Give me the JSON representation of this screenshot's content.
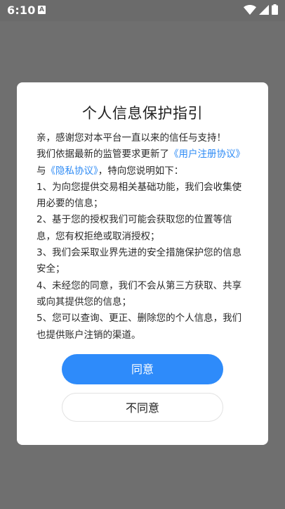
{
  "status_bar": {
    "time": "6:10",
    "notification_letter": "A"
  },
  "dialog": {
    "title": "个人信息保护指引",
    "greeting": "亲，感谢您对本平台一直以来的信任与支持！",
    "intro_prefix": "我们依据最新的监管要求更新了",
    "user_agreement_link": "《用户注册协议》",
    "intro_and": "与",
    "privacy_link": "《隐私协议》",
    "intro_suffix": "，特向您说明如下：",
    "points": [
      "1、为向您提供交易相关基础功能，我们会收集使用必要的信息；",
      "2、基于您的授权我们可能会获取您的位置等信息，您有权拒绝或取消授权；",
      "3、我们会采取业界先进的安全措施保护您的信息安全；",
      "4、未经您的同意，我们不会从第三方获取、共享或向其提供您的信息；",
      "5、您可以查询、更正、删除您的个人信息，我们也提供账户注销的渠道。"
    ],
    "agree_label": "同意",
    "disagree_label": "不同意"
  },
  "colors": {
    "accent": "#2e8bfa",
    "link": "#2e8bf5",
    "overlay": "#6f6f6f"
  }
}
